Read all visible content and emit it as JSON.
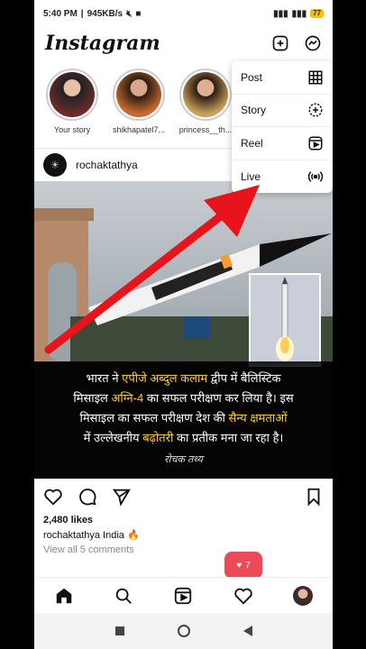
{
  "status_bar": {
    "time": "5:40 PM",
    "speed": "945KB/s",
    "battery": "77"
  },
  "header": {
    "logo": "Instagram",
    "icons": [
      "plus-square-icon",
      "messenger-icon"
    ]
  },
  "stories": [
    {
      "label": "Your story"
    },
    {
      "label": "shikhapatel7..."
    },
    {
      "label": "princess__th..."
    }
  ],
  "create_menu": {
    "items": [
      {
        "label": "Post",
        "icon": "grid-icon"
      },
      {
        "label": "Story",
        "icon": "story-plus-icon"
      },
      {
        "label": "Reel",
        "icon": "reel-icon"
      },
      {
        "label": "Live",
        "icon": "live-icon"
      }
    ]
  },
  "post": {
    "username": "rochaktathya",
    "caption_lines": [
      {
        "parts": [
          [
            "भारत ने ",
            false
          ],
          [
            "एपीजे अब्दुल कलाम",
            true
          ],
          [
            " द्वीप में बैलिस्टिक",
            false
          ]
        ]
      },
      {
        "parts": [
          [
            "मिसाइल ",
            false
          ],
          [
            "अग्नि-4",
            true
          ],
          [
            " का सफल परीक्षण कर लिया है। इस",
            false
          ]
        ]
      },
      {
        "parts": [
          [
            "मिसाइल का सफल परीक्षण देश की ",
            false
          ],
          [
            "सैन्य क्षमताओं",
            true
          ]
        ]
      },
      {
        "parts": [
          [
            "में उल्लेखनीय ",
            false
          ],
          [
            "बढ़ोतरी",
            true
          ],
          [
            " का प्रतीक मना जा रहा है।",
            false
          ]
        ]
      }
    ],
    "brand_watermark": "रोचक तथ्य",
    "likes": "2,480 likes",
    "caption_user": "rochaktathya",
    "caption_text": "India 🔥",
    "comments_link": "View all 5 comments"
  },
  "notification": {
    "count": "7"
  },
  "colors": {
    "accent": "#ed4956",
    "highlight": "#ffcc33",
    "arrow": "#e8141b"
  }
}
